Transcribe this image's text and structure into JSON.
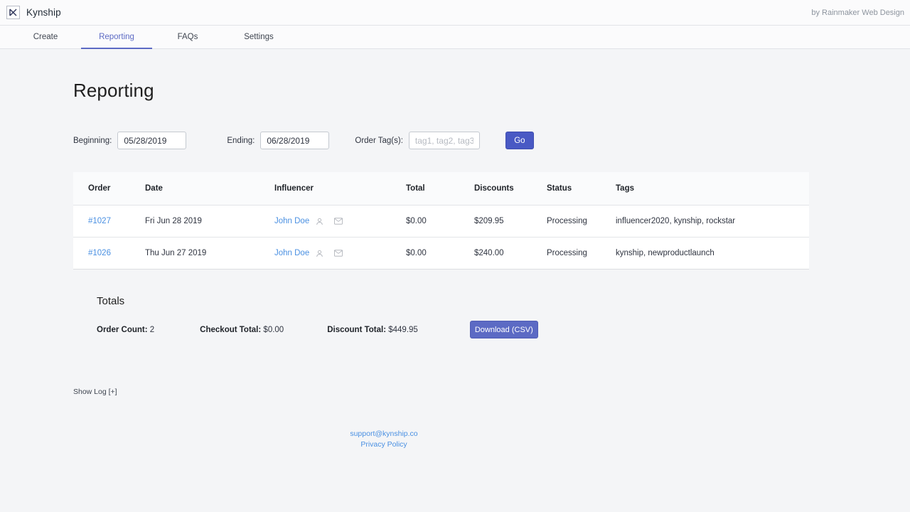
{
  "topbar": {
    "brand_name": "Kynship",
    "logo_icon": "kynship-k-logo",
    "byline": "by Rainmaker Web Design"
  },
  "nav": {
    "tabs": [
      {
        "label": "Create",
        "active": false
      },
      {
        "label": "Reporting",
        "active": true
      },
      {
        "label": "FAQs",
        "active": false
      },
      {
        "label": "Settings",
        "active": false
      }
    ]
  },
  "page": {
    "title": "Reporting"
  },
  "filters": {
    "beginning_label": "Beginning:",
    "beginning_value": "05/28/2019",
    "ending_label": "Ending:",
    "ending_value": "06/28/2019",
    "tags_label": "Order Tag(s):",
    "tags_value": "",
    "tags_placeholder": "tag1, tag2, tag3",
    "go_label": "Go"
  },
  "table": {
    "columns": [
      "Order",
      "Date",
      "Influencer",
      "Total",
      "Discounts",
      "Status",
      "Tags"
    ],
    "rows": [
      {
        "order": "#1027",
        "date": "Fri Jun 28 2019",
        "influencer": "John Doe",
        "total": "$0.00",
        "discounts": "$209.95",
        "status": "Processing",
        "tags": "influencer2020, kynship, rockstar",
        "profile_icon": "user-icon",
        "email_icon": "envelope-icon"
      },
      {
        "order": "#1026",
        "date": "Thu Jun 27 2019",
        "influencer": "John Doe",
        "total": "$0.00",
        "discounts": "$240.00",
        "status": "Processing",
        "tags": "kynship, newproductlaunch",
        "profile_icon": "user-icon",
        "email_icon": "envelope-icon"
      }
    ]
  },
  "totals": {
    "title": "Totals",
    "order_count_label": "Order Count:",
    "order_count_value": "2",
    "checkout_total_label": "Checkout Total:",
    "checkout_total_value": "$0.00",
    "discount_total_label": "Discount Total:",
    "discount_total_value": "$449.95",
    "download_label": "Download (CSV)"
  },
  "log": {
    "show_log_label": "Show Log [+]"
  },
  "footer": {
    "support_email": "support@kynship.co",
    "privacy_policy": "Privacy Policy"
  },
  "colors": {
    "accent": "#5c6ac4",
    "go_button": "#4959c4",
    "link": "#4a90e2",
    "page_bg": "#f4f5f7"
  }
}
